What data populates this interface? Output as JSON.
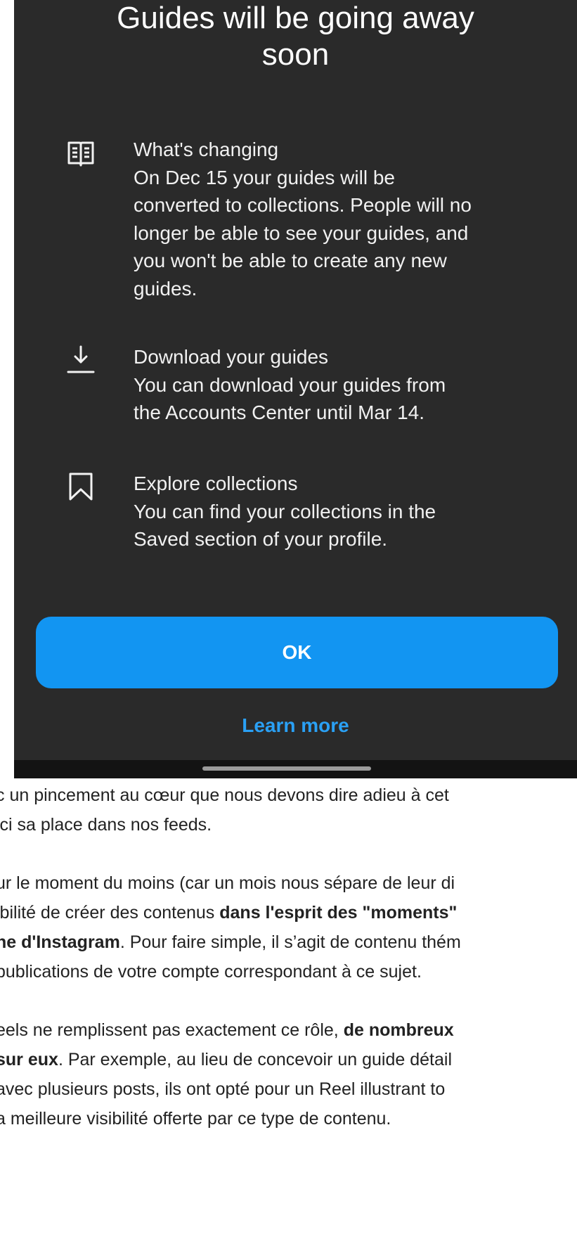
{
  "modal": {
    "title_line1": "Guides will be going away",
    "title_line2": "soon",
    "items": [
      {
        "icon": "book-icon",
        "heading": "What's changing",
        "body_lines": [
          "On Dec 15 your guides will be",
          "converted to collections. People will no",
          "longer be able to see your guides, and",
          "you won't be able to create any new",
          "guides."
        ]
      },
      {
        "icon": "download-icon",
        "heading": "Download your guides",
        "body_lines": [
          "You can download your guides from",
          "the Accounts Center until Mar 14."
        ]
      },
      {
        "icon": "bookmark-icon",
        "heading": "Explore collections",
        "body_lines": [
          "You can find your collections in the",
          "Saved section of your profile."
        ]
      }
    ],
    "ok_label": "OK",
    "learn_more_label": "Learn more",
    "accent_color": "#1295f2"
  },
  "article": {
    "p1": [
      "c un pincement au cœur que nous devons dire adieu à cet",
      "ici sa place dans nos feeds."
    ],
    "p2": {
      "l1": "ur le moment du moins (car un mois nous sépare de leur di",
      "l2_a": "ibilité de créer des contenus ",
      "l2_b": "dans l'esprit des \"moments\"",
      "l3_a": "ne d'Instagram",
      "l3_b": ". Pour faire simple, il s’agit de contenu thém",
      "l4": " publications de votre compte correspondant à ce sujet."
    },
    "p3": {
      "l1_a": "eels ne remplissent pas exactement ce rôle, ",
      "l1_b": "de nombreux",
      "l2_a": "sur eux",
      "l2_b": ". Par exemple, au lieu de concevoir un guide détail",
      "l3": " avec plusieurs posts, ils ont opté pour un Reel illustrant to",
      "l4": "a meilleure visibilité offerte par ce type de contenu."
    }
  }
}
